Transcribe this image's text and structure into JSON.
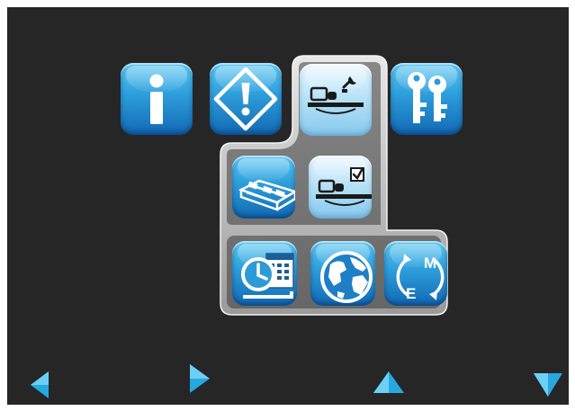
{
  "menu": {
    "rows": [
      {
        "items": [
          {
            "id": "information",
            "icon": "information-icon"
          },
          {
            "id": "warning",
            "icon": "warning-diamond-icon"
          },
          {
            "id": "machine-setup",
            "icon": "machine-wrench-icon",
            "selected": true
          },
          {
            "id": "access-keys",
            "icon": "keys-icon"
          }
        ]
      },
      {
        "items": [
          {
            "id": "conveyor",
            "icon": "conveyor-belt-icon"
          },
          {
            "id": "machine-check",
            "icon": "machine-checkbox-icon",
            "selected": true
          }
        ]
      },
      {
        "items": [
          {
            "id": "date-time",
            "icon": "clock-calendar-icon"
          },
          {
            "id": "language",
            "icon": "globe-icon"
          },
          {
            "id": "units",
            "icon": "metric-imperial-icon"
          }
        ]
      }
    ],
    "units_metric_label": "M",
    "units_imperial_label": "E"
  },
  "navigation": [
    {
      "id": "nav-left",
      "icon": "arrow-left-icon"
    },
    {
      "id": "nav-right",
      "icon": "arrow-right-icon"
    },
    {
      "id": "nav-up",
      "icon": "arrow-up-icon"
    },
    {
      "id": "nav-down",
      "icon": "arrow-down-icon"
    }
  ],
  "colors": {
    "background": "#262626",
    "tile_blue": "#2fa0dc",
    "tile_selected": "#b9e3f8",
    "highlight_frame": "#d6d6d6",
    "arrow": "#28a8e0"
  }
}
